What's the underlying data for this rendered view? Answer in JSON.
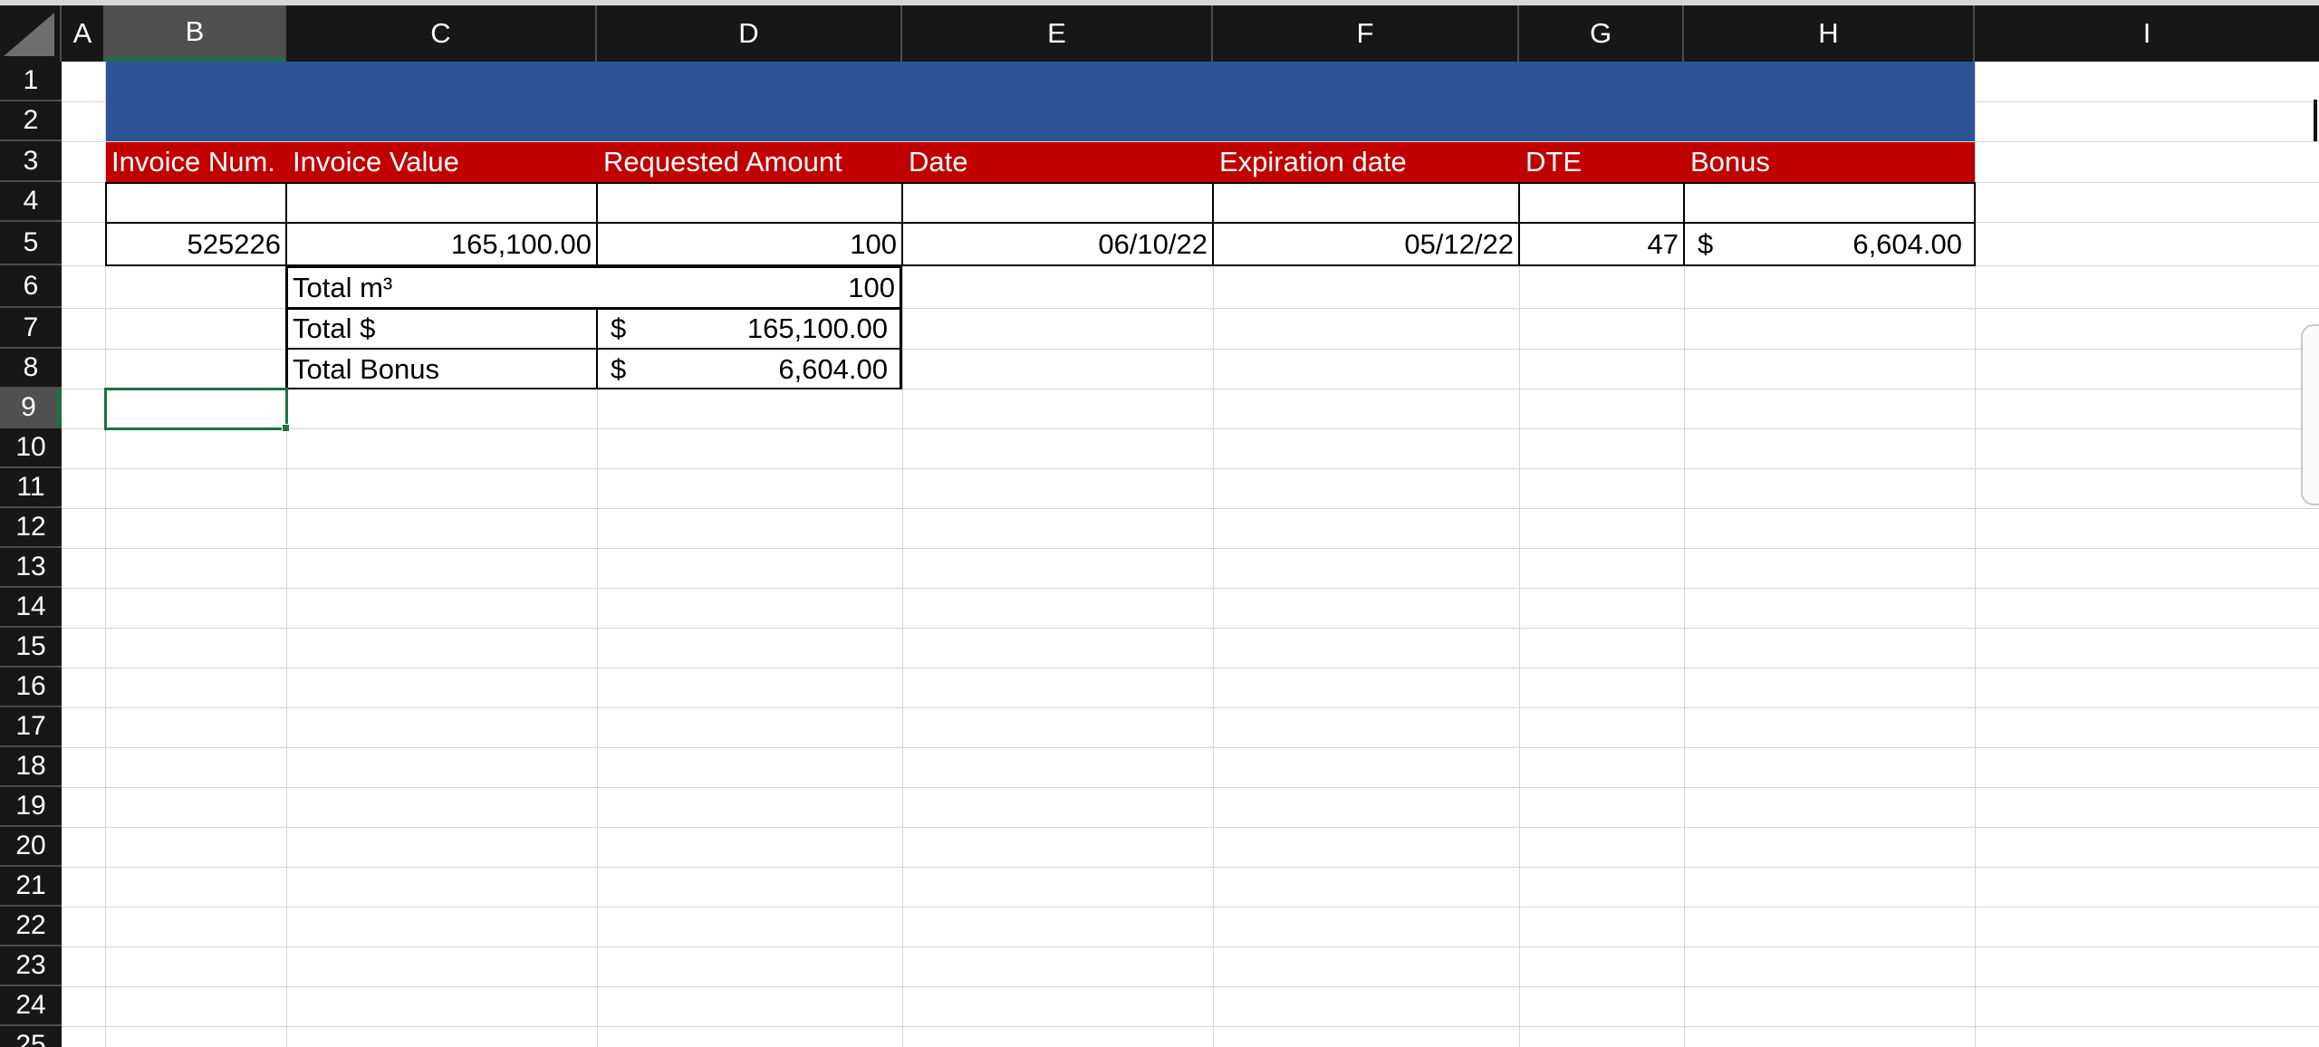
{
  "columns": [
    "A",
    "B",
    "C",
    "D",
    "E",
    "F",
    "G",
    "H",
    "I"
  ],
  "selected_column": "B",
  "rows": [
    "1",
    "2",
    "3",
    "4",
    "5",
    "6",
    "7",
    "8",
    "9",
    "10",
    "11",
    "12",
    "13",
    "14",
    "15",
    "16",
    "17",
    "18",
    "19",
    "20",
    "21",
    "22",
    "23",
    "24",
    "25"
  ],
  "selected_row": "9",
  "colors": {
    "title_band": "#2f5496",
    "header_band": "#c00000",
    "header_text": "#ffffff",
    "selection": "#1d7044",
    "chrome": "#171717"
  },
  "table": {
    "headers": {
      "B": "Invoice Num.",
      "C": "Invoice Value",
      "D": "Requested Amount",
      "E": "Date",
      "F": "Expiration date",
      "G": "DTE",
      "H": "Bonus"
    },
    "row5": {
      "B": "525226",
      "C": "165,100.00",
      "D": "100",
      "E": "06/10/22",
      "F": "05/12/22",
      "G": "47",
      "H_symbol": "$",
      "H_value": "6,604.00"
    }
  },
  "totals": {
    "m3_label": "Total m³",
    "m3_value": "100",
    "dollar_label": "Total $",
    "dollar_symbol": "$",
    "dollar_value": "165,100.00",
    "bonus_label": "Total Bonus",
    "bonus_symbol": "$",
    "bonus_value": "6,604.00"
  },
  "active_cell": "B9"
}
